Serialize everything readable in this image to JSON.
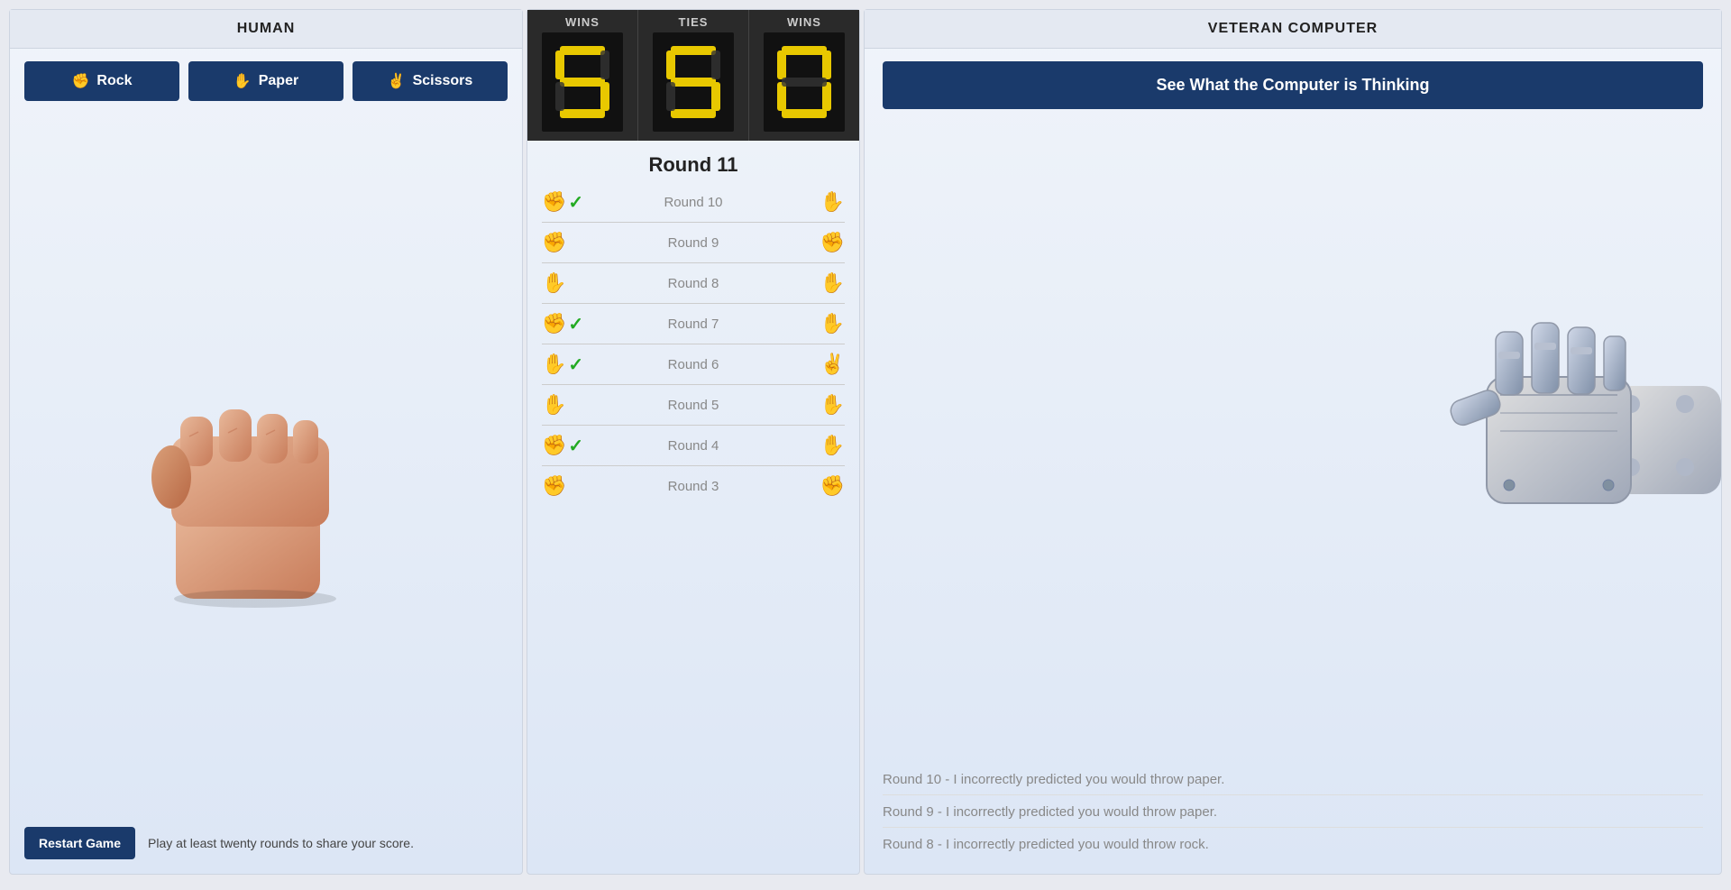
{
  "left": {
    "header": "HUMAN",
    "buttons": [
      {
        "label": "Rock",
        "icon": "✊",
        "name": "rock-button"
      },
      {
        "label": "Paper",
        "icon": "✋",
        "name": "paper-button"
      },
      {
        "label": "Scissors",
        "icon": "✌",
        "name": "scissors-button"
      }
    ],
    "restart_label": "Restart Game",
    "bottom_text": "Play at least twenty rounds to share your score."
  },
  "center": {
    "score_cols": [
      {
        "label": "WINS",
        "value": 5
      },
      {
        "label": "TIES",
        "value": 5
      },
      {
        "label": "WINS",
        "value": 0
      }
    ],
    "current_round_label": "Round 11",
    "rounds": [
      {
        "name": "Round 10",
        "human_icon": "✊",
        "human_win": true,
        "computer_icon": "✋",
        "computer_win": false,
        "muted": true
      },
      {
        "name": "Round 9",
        "human_icon": "✊",
        "human_win": false,
        "computer_icon": "✊",
        "computer_win": false,
        "muted": false
      },
      {
        "name": "Round 8",
        "human_icon": "✋",
        "human_win": false,
        "computer_icon": "✋",
        "computer_win": false,
        "muted": false
      },
      {
        "name": "Round 7",
        "human_icon": "✊",
        "human_win": true,
        "computer_icon": "✋",
        "computer_win": false,
        "muted": true
      },
      {
        "name": "Round 6",
        "human_icon": "✋",
        "human_win": true,
        "computer_icon": "✌",
        "computer_win": false,
        "muted": true
      },
      {
        "name": "Round 5",
        "human_icon": "✋",
        "human_win": false,
        "computer_icon": "✋",
        "computer_win": false,
        "muted": false
      },
      {
        "name": "Round 4",
        "human_icon": "✊",
        "human_win": true,
        "computer_icon": "✋",
        "computer_win": false,
        "muted": true
      },
      {
        "name": "Round 3",
        "human_icon": "✊",
        "human_win": false,
        "computer_icon": "✊",
        "computer_win": false,
        "muted": false
      }
    ]
  },
  "right": {
    "header": "VETERAN COMPUTER",
    "thinking_btn_label": "See What the Computer is Thinking",
    "thinking_log": [
      "Round 10 - I incorrectly predicted you would throw paper.",
      "Round 9 - I incorrectly predicted you would throw paper.",
      "Round 8 - I incorrectly predicted you would throw rock."
    ]
  }
}
